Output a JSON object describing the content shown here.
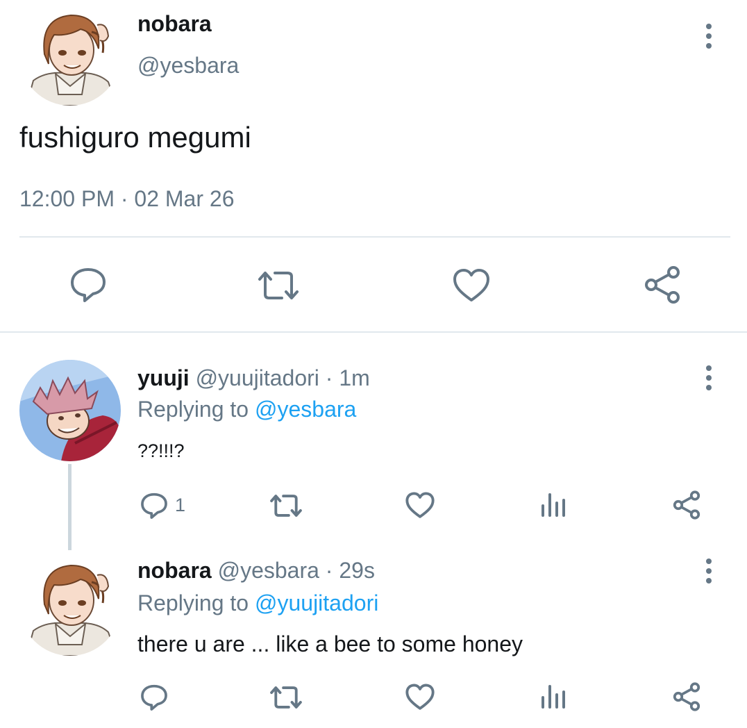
{
  "main_tweet": {
    "display_name": "nobara",
    "handle": "@yesbara",
    "text": "fushiguro megumi",
    "timestamp": "12:00 PM · 02 Mar 26"
  },
  "replies": [
    {
      "display_name": "yuuji",
      "handle": "@yuujitadori",
      "separator": "·",
      "time": "1m",
      "replying_prefix": "Replying to",
      "replying_to": "@yesbara",
      "text": "??!!!?",
      "reply_count": "1"
    },
    {
      "display_name": "nobara",
      "handle": "@yesbara",
      "separator": "·",
      "time": "29s",
      "replying_prefix": "Replying to",
      "replying_to": "@yuujitadori",
      "text": "there u are ... like a bee to some honey",
      "reply_count": ""
    }
  ],
  "icons": {
    "reply": "reply-icon",
    "retweet": "retweet-icon",
    "like": "heart-icon",
    "analytics": "analytics-icon",
    "share": "share-icon",
    "more": "more-vertical-icon"
  },
  "colors": {
    "text": "#14171a",
    "secondary": "#657786",
    "link": "#1da1f2",
    "divider": "#e1e8ed"
  }
}
